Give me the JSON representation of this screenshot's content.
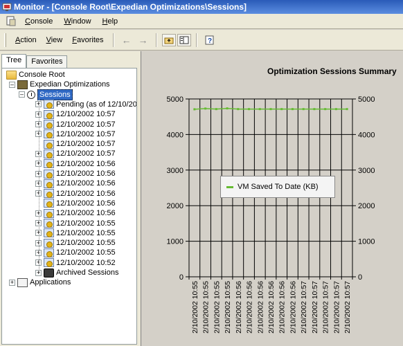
{
  "window": {
    "title": "Monitor - [Console Root\\Expedian Optimizations\\Sessions]"
  },
  "menubar": {
    "items": [
      {
        "label": "Console",
        "u": "C",
        "rest": "onsole"
      },
      {
        "label": "Window",
        "u": "W",
        "rest": "indow"
      },
      {
        "label": "Help",
        "u": "H",
        "rest": "elp"
      }
    ]
  },
  "toolbar": {
    "menus": [
      {
        "u": "A",
        "rest": "ction"
      },
      {
        "u": "V",
        "rest": "iew"
      },
      {
        "u": "F",
        "rest": "avorites"
      }
    ]
  },
  "tabs": [
    "Tree",
    "Favorites"
  ],
  "tree": {
    "root": "Console Root",
    "expedian": "Expedian Optimizations",
    "sessions": "Sessions",
    "items": [
      {
        "label": "Pending (as of 12/10/20",
        "expandable": true
      },
      {
        "label": "12/10/2002 10:57",
        "expandable": true
      },
      {
        "label": "12/10/2002 10:57",
        "expandable": true
      },
      {
        "label": "12/10/2002 10:57",
        "expandable": true
      },
      {
        "label": "12/10/2002 10:57",
        "expandable": false
      },
      {
        "label": "12/10/2002 10:57",
        "expandable": true
      },
      {
        "label": "12/10/2002 10:56",
        "expandable": true
      },
      {
        "label": "12/10/2002 10:56",
        "expandable": true
      },
      {
        "label": "12/10/2002 10:56",
        "expandable": true
      },
      {
        "label": "12/10/2002 10:56",
        "expandable": true
      },
      {
        "label": "12/10/2002 10:56",
        "expandable": false
      },
      {
        "label": "12/10/2002 10:56",
        "expandable": true
      },
      {
        "label": "12/10/2002 10:55",
        "expandable": true
      },
      {
        "label": "12/10/2002 10:55",
        "expandable": true
      },
      {
        "label": "12/10/2002 10:55",
        "expandable": true
      },
      {
        "label": "12/10/2002 10:55",
        "expandable": true
      },
      {
        "label": "12/10/2002 10:52",
        "expandable": true
      },
      {
        "label": "Archived Sessions",
        "expandable": true,
        "icon": "archive"
      }
    ],
    "applications": "Applications"
  },
  "chart_data": {
    "type": "line",
    "title": "Optimization Sessions Summary",
    "categories": [
      "2/10/2002 10:55",
      "2/10/2002 10:55",
      "2/10/2002 10:55",
      "2/10/2002 10:55",
      "2/10/2002 10:56",
      "2/10/2002 10:56",
      "2/10/2002 10:56",
      "2/10/2002 10:56",
      "2/10/2002 10:56",
      "2/10/2002 10:56",
      "2/10/2002 10:57",
      "2/10/2002 10:57",
      "2/10/2002 10:57",
      "2/10/2002 10:57",
      "2/10/2002 10:57"
    ],
    "series": [
      {
        "name": "VM Saved To Date (KB)",
        "values": [
          4710,
          4730,
          4715,
          4735,
          4715,
          4715,
          4715,
          4715,
          4715,
          4715,
          4715,
          4715,
          4715,
          4715,
          4715
        ]
      }
    ],
    "ylim": [
      0,
      5000
    ],
    "yticks": [
      "0",
      "1000",
      "2000",
      "3000",
      "4000",
      "5000"
    ],
    "grid": true,
    "legend_position": "center-left",
    "series_color": "#66bb33"
  }
}
